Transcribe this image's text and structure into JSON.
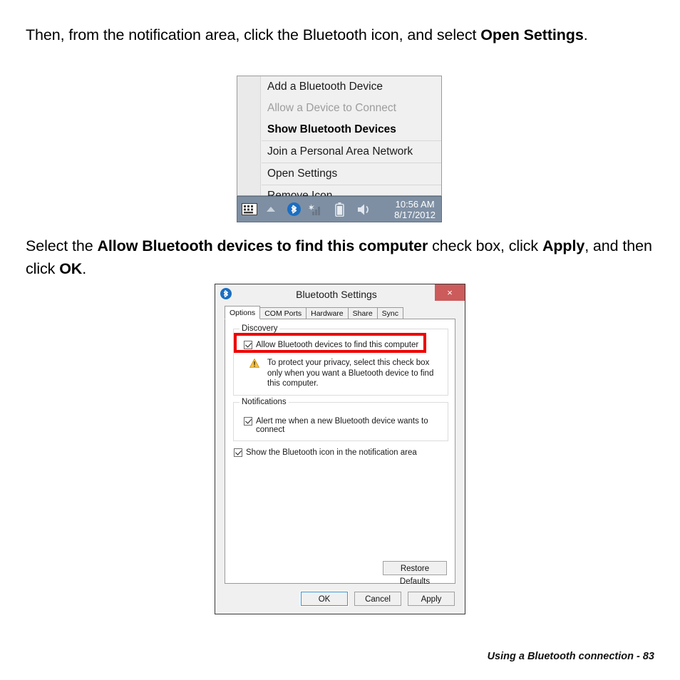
{
  "paragraphs": {
    "p1_part1": "Then, from the notification area, click the Bluetooth icon, and select ",
    "p1_bold": "Open Settings",
    "p1_part2": ".",
    "p2_part1": "Select the ",
    "p2_bold1": "Allow Bluetooth devices to find this computer",
    "p2_part2": " check box, click ",
    "p2_bold2": "Apply",
    "p2_part3": ", and then click ",
    "p2_bold3": "OK",
    "p2_part4": "."
  },
  "context_menu": {
    "items": [
      {
        "label": "Add a Bluetooth Device",
        "state": "normal"
      },
      {
        "label": "Allow a Device to Connect",
        "state": "disabled"
      },
      {
        "label": "Show Bluetooth Devices",
        "state": "bold"
      },
      {
        "label": "Join a Personal Area Network",
        "state": "normal"
      },
      {
        "label": "Open Settings",
        "state": "normal"
      },
      {
        "label": "Remove Icon",
        "state": "normal"
      }
    ],
    "taskbar": {
      "icons": [
        "keyboard-icon",
        "show-hidden-icons-chevron",
        "bluetooth-icon",
        "network-signal-icon",
        "battery-icon",
        "volume-icon"
      ],
      "time": "10:56 AM",
      "date": "8/17/2012",
      "background_color": "#7e8fa3",
      "bluetooth_icon_color": "#1b6ec2"
    }
  },
  "dialog": {
    "title": "Bluetooth Settings",
    "close_label": "×",
    "close_color": "#cc5b5b",
    "tabs": [
      {
        "label": "Options",
        "active": true
      },
      {
        "label": "COM Ports",
        "active": false
      },
      {
        "label": "Hardware",
        "active": false
      },
      {
        "label": "Share",
        "active": false
      },
      {
        "label": "Sync",
        "active": false
      }
    ],
    "discovery": {
      "group_label": "Discovery",
      "checkbox_label": "Allow Bluetooth devices to find this computer",
      "checkbox_checked": true,
      "warning_text": "To protect your privacy, select this check box only when you want a Bluetooth device to find this computer.",
      "warning_icon_color": "#f2b705"
    },
    "notifications": {
      "group_label": "Notifications",
      "checkbox_label": "Alert me when a new Bluetooth device wants to connect",
      "checkbox_checked": true
    },
    "show_icon": {
      "checkbox_label": "Show the Bluetooth icon in the notification area",
      "checkbox_checked": true
    },
    "restore_defaults_label": "Restore Defaults",
    "buttons": {
      "ok": "OK",
      "cancel": "Cancel",
      "apply": "Apply"
    },
    "highlight_color": "#ee0000"
  },
  "footer": {
    "text": "Using a Bluetooth connection -  83"
  }
}
